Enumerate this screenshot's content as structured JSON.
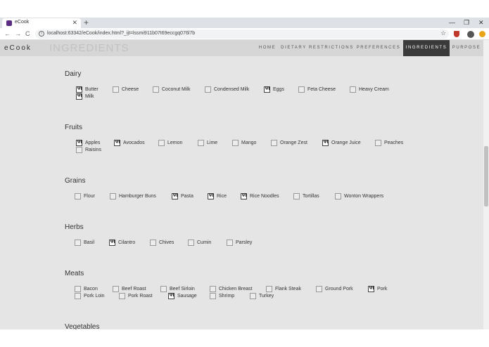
{
  "browser": {
    "tab_title": "eCook",
    "tab_close": "✕",
    "new_tab": "+",
    "minimize": "—",
    "restore": "❐",
    "close": "✕",
    "back": "←",
    "forward": "→",
    "reload": "C",
    "info": "i",
    "url": "localhost:63342/eCook/index.html?_ijt=lssmi911b07t69eccgq076l7b",
    "star": "☆"
  },
  "page": {
    "brand": "eCook",
    "heading": "INGREDIENTS",
    "nav": [
      "HOME",
      "DIETARY RESTRICTIONS",
      "PREFERENCES",
      "INGREDIENTS",
      "PURPOSE"
    ],
    "active_nav": "INGREDIENTS",
    "check_glyph": "🍴"
  },
  "sections": [
    {
      "title": "Dairy",
      "items": [
        {
          "label": "Butter",
          "checked": true
        },
        {
          "label": "Cheese",
          "checked": false
        },
        {
          "label": "Coconut Milk",
          "checked": false
        },
        {
          "label": "Condensed Milk",
          "checked": false
        },
        {
          "label": "Eggs",
          "checked": true
        },
        {
          "label": "Feta Cheese",
          "checked": false
        },
        {
          "label": "Heavy Cream",
          "checked": false
        },
        {
          "label": "Milk",
          "checked": true
        }
      ]
    },
    {
      "title": "Fruits",
      "items": [
        {
          "label": "Apples",
          "checked": true
        },
        {
          "label": "Avocados",
          "checked": true
        },
        {
          "label": "Lemon",
          "checked": false
        },
        {
          "label": "Lime",
          "checked": false
        },
        {
          "label": "Mango",
          "checked": false
        },
        {
          "label": "Orange Zest",
          "checked": false
        },
        {
          "label": "Orange Juice",
          "checked": true
        },
        {
          "label": "Peaches",
          "checked": false
        },
        {
          "label": "Raisins",
          "checked": false
        }
      ]
    },
    {
      "title": "Grains",
      "items": [
        {
          "label": "Flour",
          "checked": false
        },
        {
          "label": "Hamburger Buns",
          "checked": false
        },
        {
          "label": "Pasta",
          "checked": true
        },
        {
          "label": "Rice",
          "checked": true
        },
        {
          "label": "Rice Noodles",
          "checked": true
        },
        {
          "label": "Tortillas",
          "checked": false
        },
        {
          "label": "Wonton Wrappers",
          "checked": false
        }
      ]
    },
    {
      "title": "Herbs",
      "items": [
        {
          "label": "Basil",
          "checked": false
        },
        {
          "label": "Cilantro",
          "checked": true
        },
        {
          "label": "Chives",
          "checked": false
        },
        {
          "label": "Cumin",
          "checked": false
        },
        {
          "label": "Parsley",
          "checked": false
        }
      ]
    },
    {
      "title": "Meats",
      "items": [
        {
          "label": "Bacon",
          "checked": false
        },
        {
          "label": "Beef Roast",
          "checked": false
        },
        {
          "label": "Beef Sirloin",
          "checked": false
        },
        {
          "label": "Chicken Breast",
          "checked": false
        },
        {
          "label": "Flank Steak",
          "checked": false
        },
        {
          "label": "Ground Pork",
          "checked": false
        },
        {
          "label": "Pork",
          "checked": true
        },
        {
          "label": "Pork Loin",
          "checked": false
        },
        {
          "label": "Pork Roast",
          "checked": false
        },
        {
          "label": "Sausage",
          "checked": true
        },
        {
          "label": "Shrimp",
          "checked": false
        },
        {
          "label": "Turkey",
          "checked": false
        }
      ]
    },
    {
      "title": "Vegetables",
      "items": []
    }
  ]
}
